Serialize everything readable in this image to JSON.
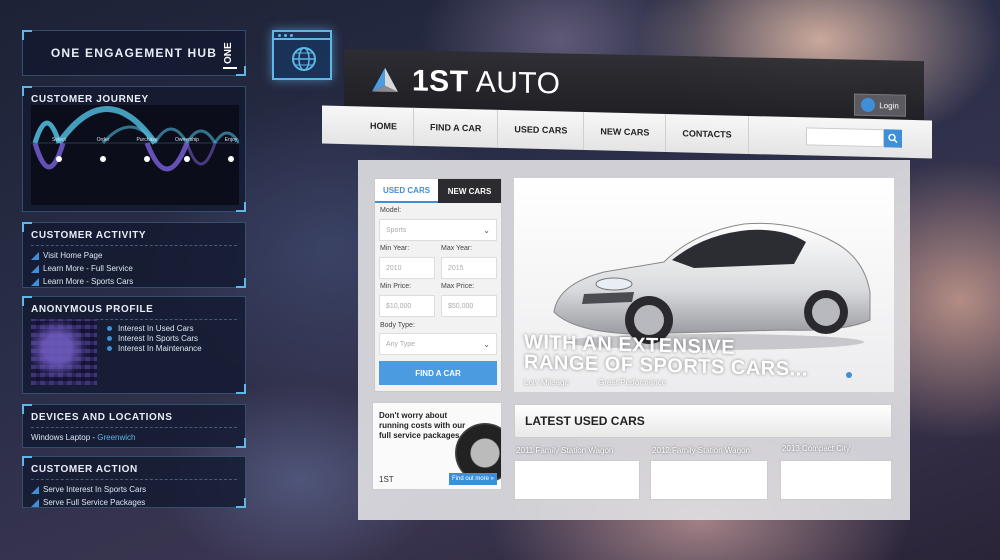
{
  "hub": {
    "title": "ONE ENGAGEMENT HUB",
    "logo_text": "ONE"
  },
  "journey": {
    "title": "CUSTOMER JOURNEY",
    "stages": [
      "Select",
      "Order",
      "Purchase",
      "Ownership",
      "Enjoy"
    ]
  },
  "activity": {
    "title": "CUSTOMER ACTIVITY",
    "items": [
      "Visit Home Page",
      "Learn More - Full Service",
      "Learn More - Sports Cars"
    ]
  },
  "profile": {
    "title": "ANONYMOUS PROFILE",
    "items": [
      "Interest In Used Cars",
      "Interest In Sports Cars",
      "Interest In Maintenance"
    ]
  },
  "devices": {
    "title": "DEVICES AND LOCATIONS",
    "device": "Windows Laptop",
    "separator": " - ",
    "location": "Greenwich"
  },
  "action": {
    "title": "CUSTOMER ACTION",
    "items": [
      "Serve Interest In Sports Cars",
      "Serve Full Service Packages"
    ]
  },
  "site": {
    "logo_bold": "1ST",
    "logo_light": " AUTO",
    "login_label": "Login",
    "nav": [
      "HOME",
      "FIND A CAR",
      "USED CARS",
      "NEW CARS",
      "CONTACTS"
    ],
    "finder": {
      "tab_used": "USED CARS",
      "tab_new": "NEW CARS",
      "model_label": "Model:",
      "model_value": "Sports",
      "min_year_label": "Min Year:",
      "min_year_value": "2010",
      "max_year_label": "Max Year:",
      "max_year_value": "2015",
      "min_price_label": "Min Price:",
      "min_price_value": "$10,000",
      "max_price_label": "Max Price:",
      "max_price_value": "$50,000",
      "body_label": "Body Type:",
      "body_value": "Any Type",
      "button": "FIND A CAR"
    },
    "hero": {
      "line1": "WITH AN EXTENSIVE",
      "line2": "RANGE OF SPORTS CARS...",
      "sub1": "Low Mileage",
      "sub2": "Great Performance"
    },
    "promo": {
      "text": "Don't worry about running costs with our full service packages",
      "logo": "1ST",
      "button": "Find out more »"
    },
    "latest_title": "LATEST USED CARS",
    "listings": [
      "2011 Family Station Wagon",
      "2012 Family Station Wagon",
      "2013 Compact City"
    ]
  },
  "colors": {
    "accent": "#3f8fd8",
    "panel_border": "#5fb6e8",
    "journey_arc": "#4fb7d8",
    "journey_arc2": "#6f58c8"
  }
}
